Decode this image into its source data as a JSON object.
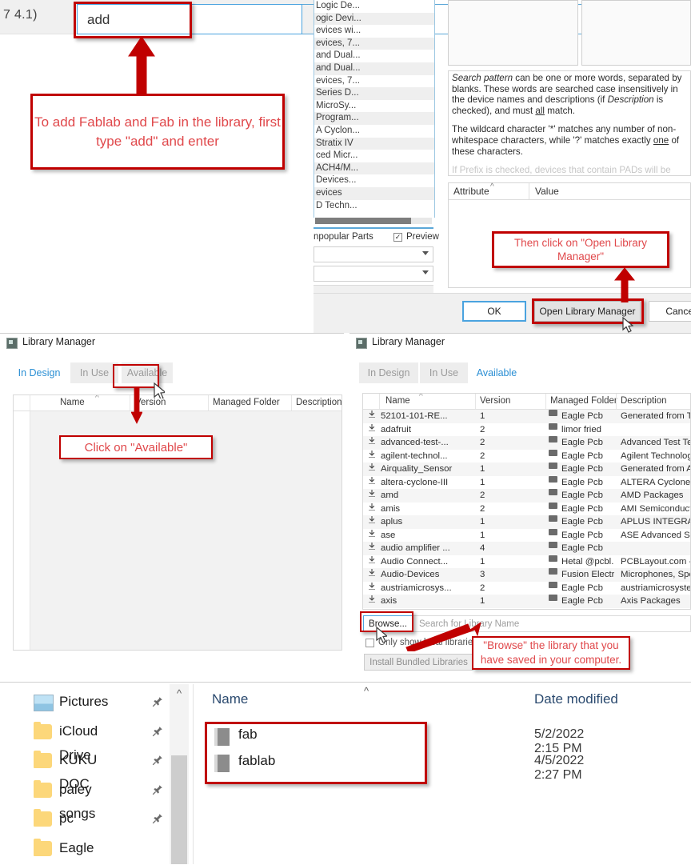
{
  "add_dialog": {
    "left_label": "7 4.1)",
    "search_value": "add",
    "device_rows": [
      "Logic De...",
      "ogic Devi...",
      "evices wi...",
      "evices, 7...",
      "and Dual...",
      "and Dual...",
      "evices, 7...",
      "Series D...",
      "MicroSy...",
      "Program...",
      "A Cyclon...",
      "Stratix IV",
      "ced Micr...",
      "ACH4/M...",
      "Devices...",
      "evices",
      "D Techn..."
    ],
    "unpopular_label": "npopular Parts",
    "preview_label": "Preview",
    "preview_checked": "✓",
    "help_p1_a": "Search pattern",
    "help_p1_b": " can be one or more words, separated by blanks. These words are searched case insensitively in the device names and descriptions (if ",
    "help_p1_c": "Description",
    "help_p1_d": " is checked), and must ",
    "help_p1_e": "all",
    "help_p1_f": " match.",
    "help_p2_a": "The wildcard character '*' matches any number of non-whitespace characters, while '?' matches exactly ",
    "help_p2_b": "one",
    "help_p2_c": " of these characters.",
    "help_p3": "If Prefix is checked, devices that contain PADs will be",
    "attr_header_attribute": "Attribute",
    "attr_header_value": "Value",
    "buttons": {
      "ok": "OK",
      "open_library_manager": "Open Library Manager",
      "cancel": "Cancel"
    }
  },
  "library_manager_left": {
    "title": "Library Manager",
    "tabs": [
      {
        "label": "In Design",
        "active": true
      },
      {
        "label": "In Use",
        "active": false
      },
      {
        "label": "Available",
        "active": false
      }
    ],
    "columns": [
      "Name",
      "Version",
      "Managed Folder",
      "Description"
    ]
  },
  "library_manager_right": {
    "title": "Library Manager",
    "tabs": [
      {
        "label": "In Design",
        "active": false
      },
      {
        "label": "In Use",
        "active": false
      },
      {
        "label": "Available",
        "active": true
      }
    ],
    "columns": [
      "Name",
      "Version",
      "Managed Folder",
      "Description"
    ],
    "rows": [
      {
        "name": "52101-101-RE...",
        "version": "1",
        "folder": "Eagle Pcb",
        "description": "Generated from Te"
      },
      {
        "name": "adafruit",
        "version": "2",
        "folder": "limor fried",
        "description": ""
      },
      {
        "name": "advanced-test-...",
        "version": "2",
        "folder": "Eagle Pcb",
        "description": "Advanced Test Te"
      },
      {
        "name": "agilent-technol...",
        "version": "2",
        "folder": "Eagle Pcb",
        "description": "Agilent Technologi"
      },
      {
        "name": "Airquality_Sensor",
        "version": "1",
        "folder": "Eagle Pcb",
        "description": "Generated from Air"
      },
      {
        "name": "altera-cyclone-III",
        "version": "1",
        "folder": "Eagle Pcb",
        "description": "ALTERA Cyclone III"
      },
      {
        "name": "amd",
        "version": "2",
        "folder": "Eagle Pcb",
        "description": "AMD Packages"
      },
      {
        "name": "amis",
        "version": "2",
        "folder": "Eagle Pcb",
        "description": "AMI Semiconductor"
      },
      {
        "name": "aplus",
        "version": "1",
        "folder": "Eagle Pcb",
        "description": "APLUS INTEGRATE"
      },
      {
        "name": "ase",
        "version": "1",
        "folder": "Eagle Pcb",
        "description": "ASE Advanced Sem"
      },
      {
        "name": "audio amplifier ...",
        "version": "4",
        "folder": "Eagle Pcb",
        "description": ""
      },
      {
        "name": "Audio Connect...",
        "version": "1",
        "folder": "Hetal @pcbl...",
        "description": "PCBLayout.com - F"
      },
      {
        "name": "Audio-Devices",
        "version": "3",
        "folder": "Fusion Electr...",
        "description": "Microphones, Speal"
      },
      {
        "name": "austriamicrosys...",
        "version": "2",
        "folder": "Eagle Pcb",
        "description": "austriamicrosystems"
      },
      {
        "name": "axis",
        "version": "1",
        "folder": "Eagle Pcb",
        "description": "Axis Packages"
      }
    ],
    "browse_button": "Browse...",
    "search_placeholder": "Search for Library Name",
    "only_local_label": "Only show local libraries",
    "install_bundled_button": "Install Bundled Libraries"
  },
  "explorer": {
    "sidebar_items": [
      {
        "label": "Pictures",
        "icon": "pictures-icon",
        "pinned": true
      },
      {
        "label": "iCloud Drive",
        "icon": "folder-icon",
        "pinned": true
      },
      {
        "label": "KUKU DOC",
        "icon": "folder-icon",
        "pinned": true
      },
      {
        "label": "paley songs",
        "icon": "folder-icon",
        "pinned": true
      },
      {
        "label": "pc",
        "icon": "folder-icon",
        "pinned": true
      },
      {
        "label": "Eagle",
        "icon": "folder-icon",
        "pinned": false
      }
    ],
    "col_name": "Name",
    "col_date": "Date modified",
    "files": [
      {
        "name": "fab",
        "date": "5/2/2022 2:15 PM"
      },
      {
        "name": "fablab",
        "date": "4/5/2022 2:27 PM"
      }
    ]
  },
  "annotations": {
    "note_add": "To add Fablab and Fab in the library, first type \"add\" and enter",
    "note_open_library_manager": "Then click on \"Open Library Manager\"",
    "note_available": "Click on \"Available\"",
    "note_browse": "\"Browse\" the library that you have saved in your computer."
  },
  "colors": {
    "annotation_border": "#c00000",
    "annotation_text": "#e0484b",
    "accent_blue": "#2b8fd4",
    "arrow_red": "#c00000"
  }
}
